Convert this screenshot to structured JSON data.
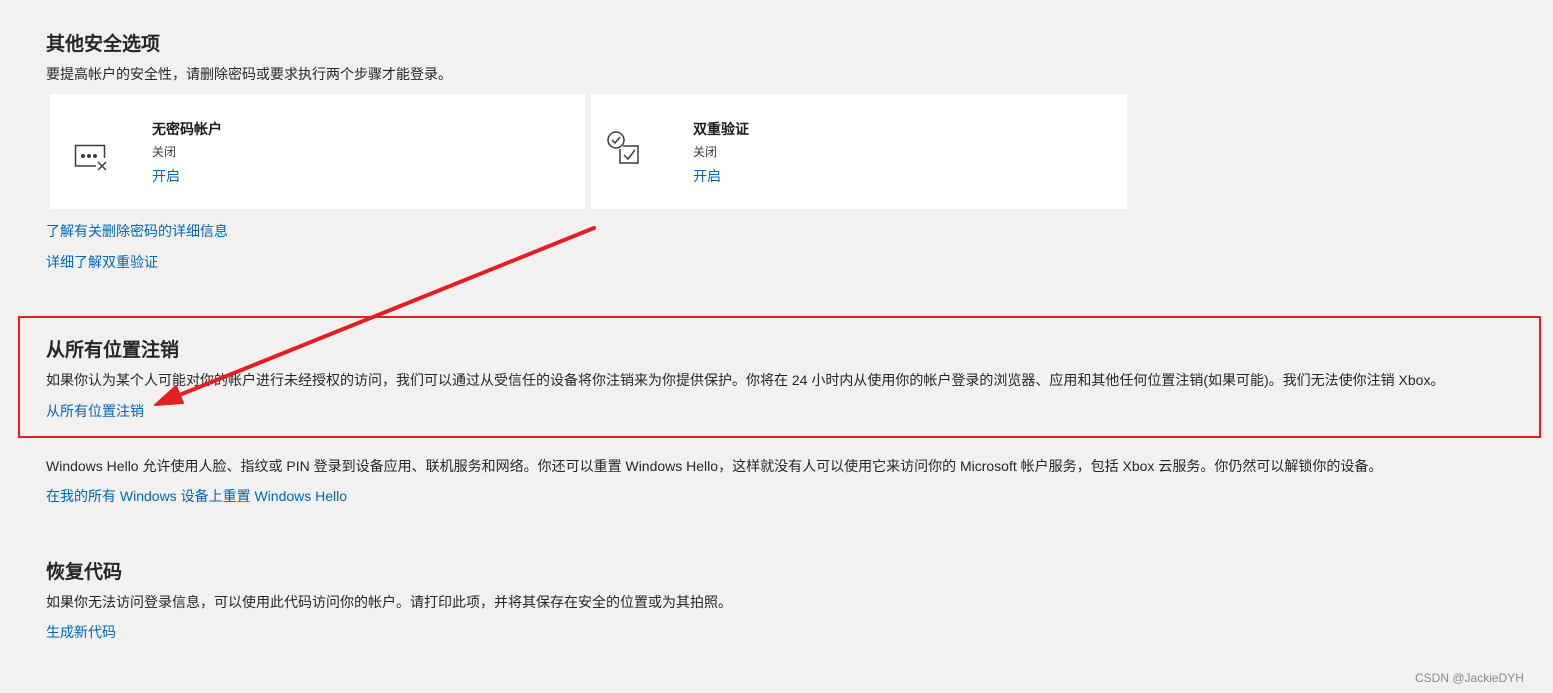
{
  "other_security": {
    "title": "其他安全选项",
    "description": "要提高帐户的安全性，请删除密码或要求执行两个步骤才能登录。",
    "cards": [
      {
        "icon": "passwordless-icon",
        "title": "无密码帐户",
        "status": "关闭",
        "action": "开启"
      },
      {
        "icon": "two-step-icon",
        "title": "双重验证",
        "status": "关闭",
        "action": "开启"
      }
    ],
    "links": [
      "了解有关删除密码的详细信息",
      "详细了解双重验证"
    ]
  },
  "sign_out_everywhere": {
    "title": "从所有位置注销",
    "description": "如果你认为某个人可能对你的帐户进行未经授权的访问，我们可以通过从受信任的设备将你注销来为你提供保护。你将在 24 小时内从使用你的帐户登录的浏览器、应用和其他任何位置注销(如果可能)。我们无法使你注销 Xbox。",
    "link": "从所有位置注销"
  },
  "windows_hello": {
    "description": "Windows Hello 允许使用人脸、指纹或 PIN 登录到设备应用、联机服务和网络。你还可以重置 Windows Hello，这样就没有人可以使用它来访问你的 Microsoft 帐户服务，包括 Xbox 云服务。你仍然可以解锁你的设备。",
    "link": "在我的所有 Windows 设备上重置 Windows Hello"
  },
  "recovery_code": {
    "title": "恢复代码",
    "description": "如果你无法访问登录信息，可以使用此代码访问你的帐户。请打印此项，并将其保存在安全的位置或为其拍照。",
    "link": "生成新代码"
  },
  "watermark": "CSDN @JackieDYH",
  "colors": {
    "link": "#0067b8",
    "highlight": "#e21f26",
    "background": "#f2f1f0",
    "card": "#ffffff"
  }
}
